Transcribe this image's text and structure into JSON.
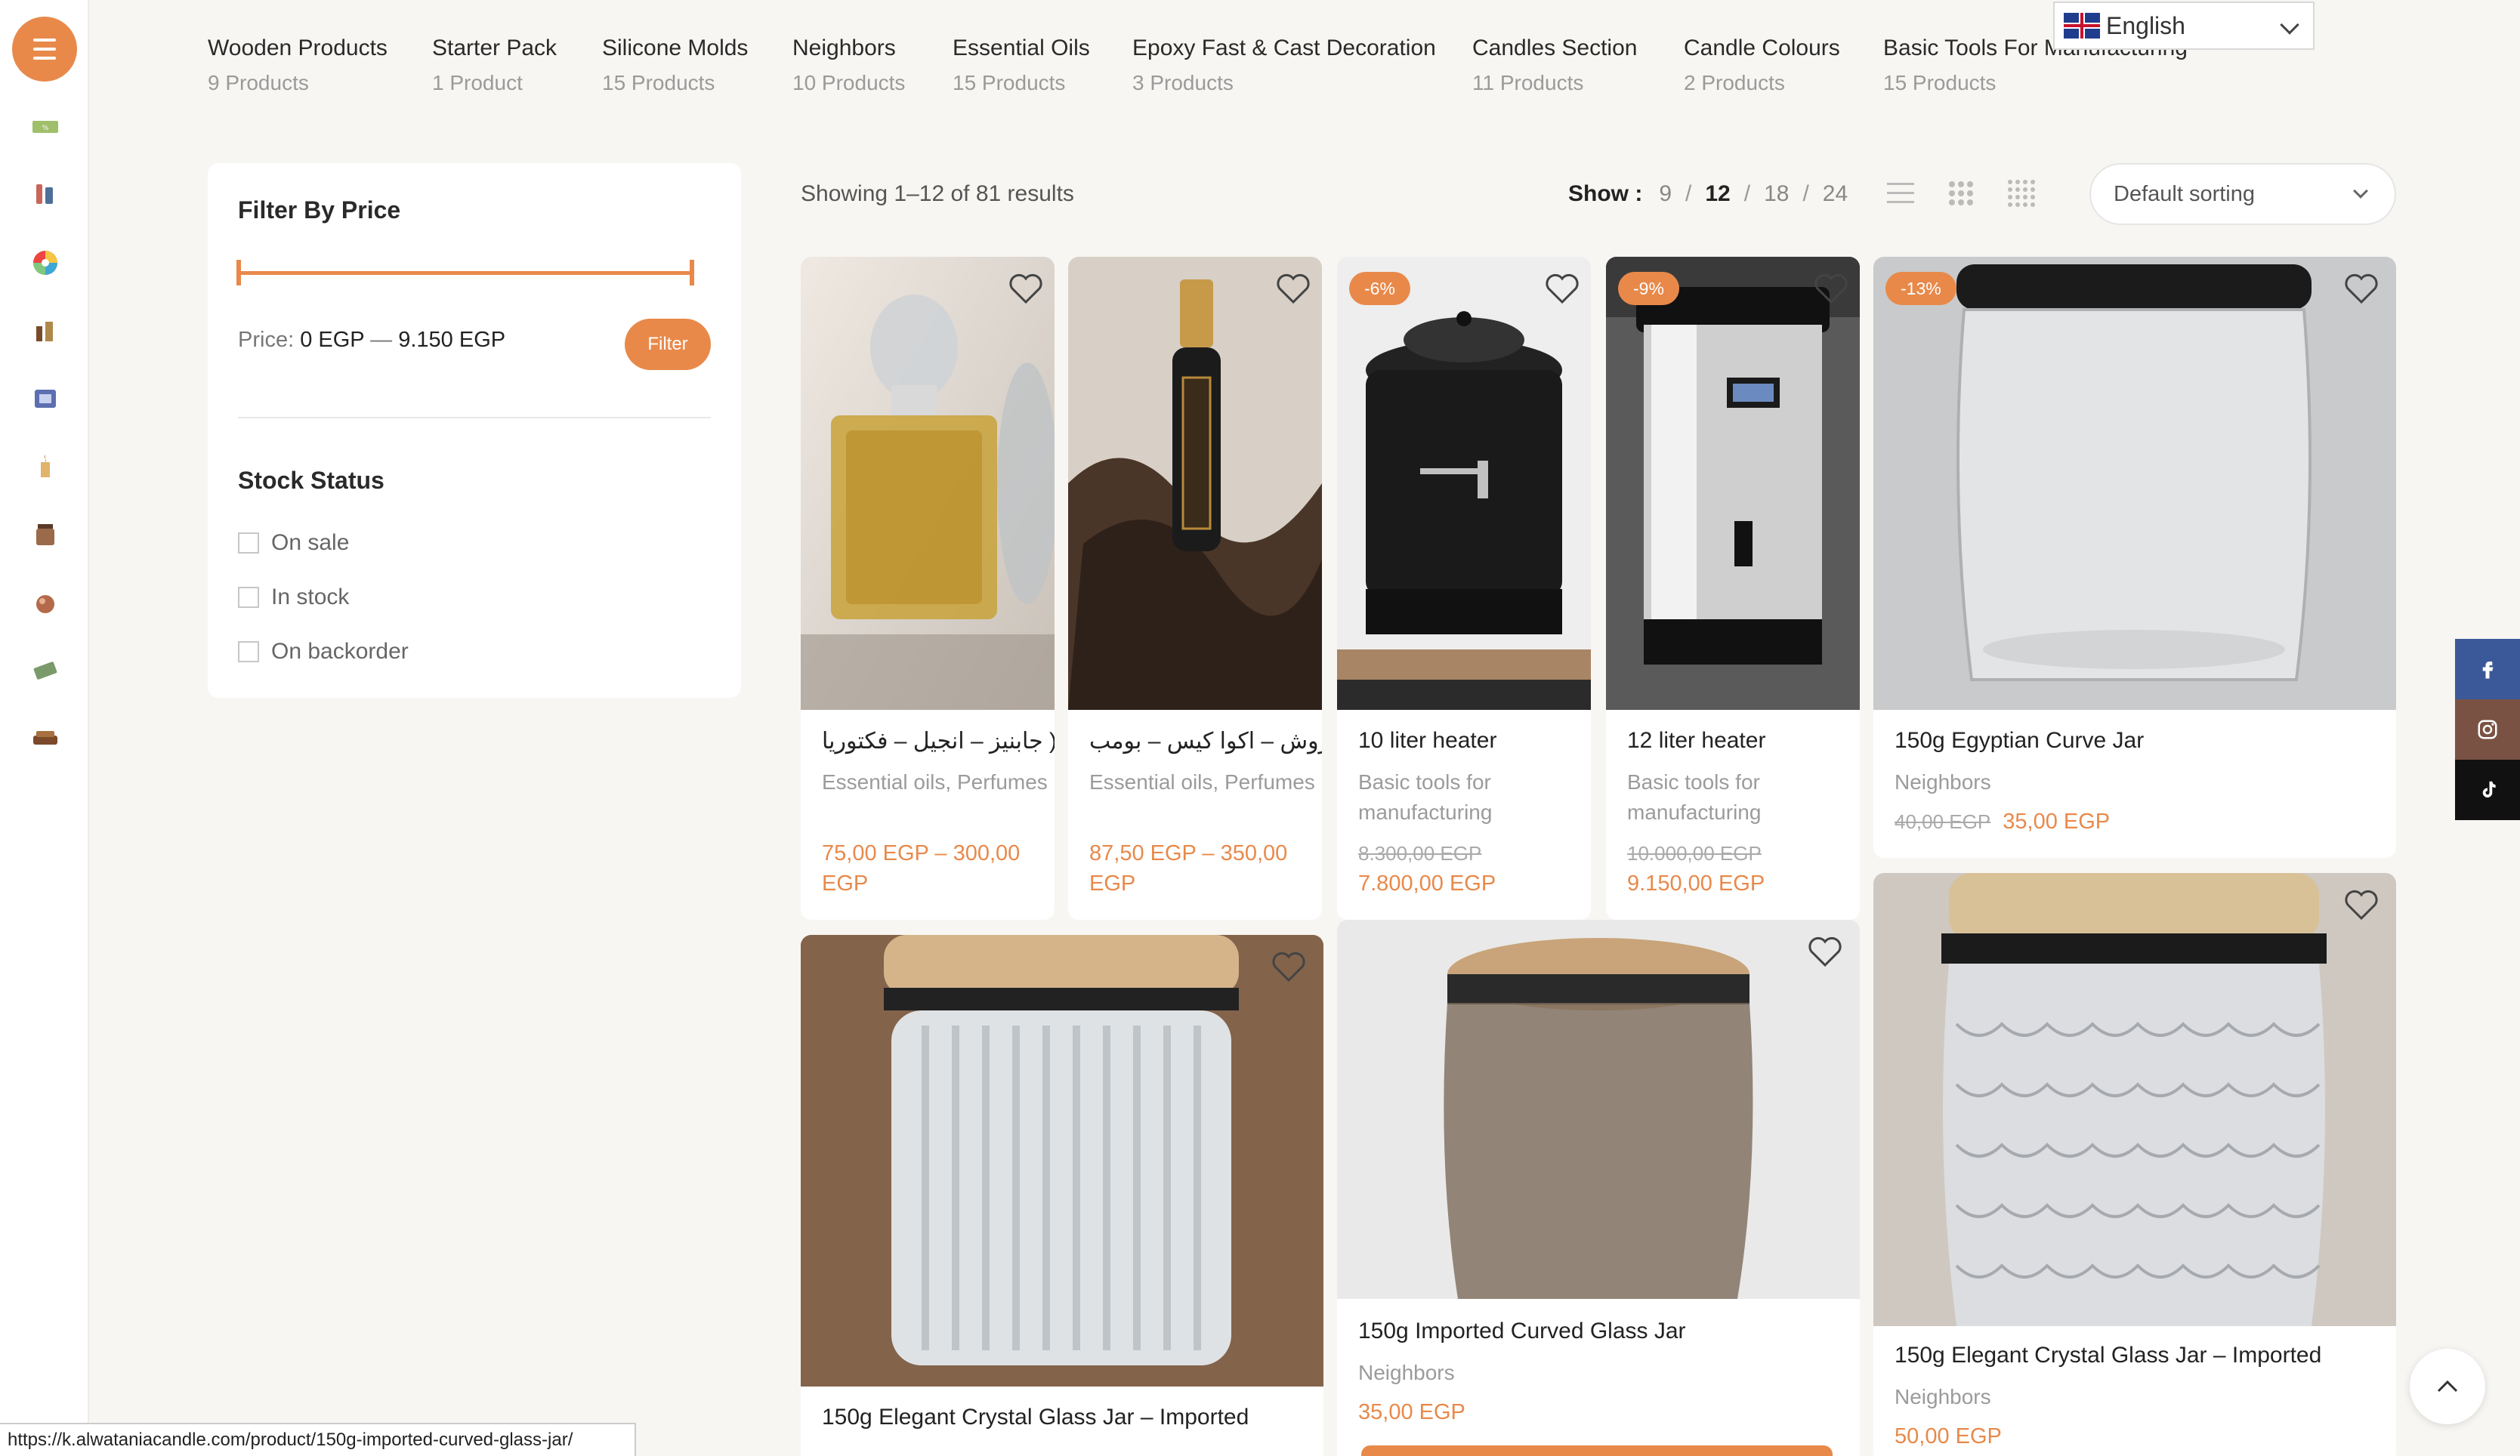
{
  "categories": [
    {
      "name": "Wooden Products",
      "count": "9 Products"
    },
    {
      "name": "Starter Pack",
      "count": "1 Product"
    },
    {
      "name": "Silicone Molds",
      "count": "15 Products"
    },
    {
      "name": "Neighbors",
      "count": "10 Products"
    },
    {
      "name": "Essential Oils",
      "count": "15 Products"
    },
    {
      "name": "Epoxy Fast & Cast Decoration",
      "count": "3 Products"
    },
    {
      "name": "Candles Section",
      "count": "11 Products"
    },
    {
      "name": "Candle Colours",
      "count": "2 Products"
    },
    {
      "name": "Basic Tools For Manufacturing",
      "count": "15 Products"
    }
  ],
  "language": {
    "label": "English"
  },
  "filter": {
    "title": "Filter By Price",
    "price_prefix": "Price:",
    "price_min": "0 EGP",
    "price_dash": "—",
    "price_max": "9.150 EGP",
    "button": "Filter"
  },
  "stock": {
    "title": "Stock Status",
    "options": [
      "On sale",
      "In stock",
      "On backorder"
    ]
  },
  "toolbar": {
    "results": "Showing 1–12 of 81 results",
    "show_label": "Show :",
    "show_options": [
      "9",
      "12",
      "18",
      "24"
    ],
    "sort": "Default sorting"
  },
  "products": [
    {
      "name": "جابنيز – انجيل – فكتوريا )",
      "category": "Essential oils, Perfumes",
      "price": "75,00 EGP – 300,00 EGP",
      "old_price": "",
      "badge": ""
    },
    {
      "name": "روش – اكوا كيس – بومب )",
      "category": "Essential oils, Perfumes",
      "price": "87,50 EGP – 350,00 EGP",
      "old_price": "",
      "badge": ""
    },
    {
      "name": "10 liter heater",
      "category": "Basic tools for manufacturing",
      "price": "7.800,00 EGP",
      "old_price": "8.300,00 EGP",
      "badge": "-6%"
    },
    {
      "name": "12 liter heater",
      "category": "Basic tools for manufacturing",
      "price": "9.150,00 EGP",
      "old_price": "10.000,00 EGP",
      "badge": "-9%"
    },
    {
      "name": "150g Egyptian Curve Jar",
      "category": "Neighbors",
      "price": "35,00 EGP",
      "old_price": "40,00 EGP",
      "badge": "-13%"
    },
    {
      "name": "150g Elegant Crystal Glass Jar – Imported",
      "category": "",
      "price": "",
      "old_price": "",
      "badge": ""
    },
    {
      "name": "150g Imported Curved Glass Jar",
      "category": "Neighbors",
      "price": "35,00 EGP",
      "old_price": "",
      "badge": ""
    },
    {
      "name": "150g Elegant Crystal Glass Jar – Imported",
      "category": "Neighbors",
      "price": "50,00 EGP",
      "old_price": "",
      "badge": ""
    }
  ],
  "status_url": "https://k.alwataniacandle.com/product/150g-imported-curved-glass-jar/",
  "colors": {
    "accent": "#e8894a",
    "facebook": "#3b5998",
    "instagram": "#7a5244",
    "tiktok": "#111111"
  }
}
